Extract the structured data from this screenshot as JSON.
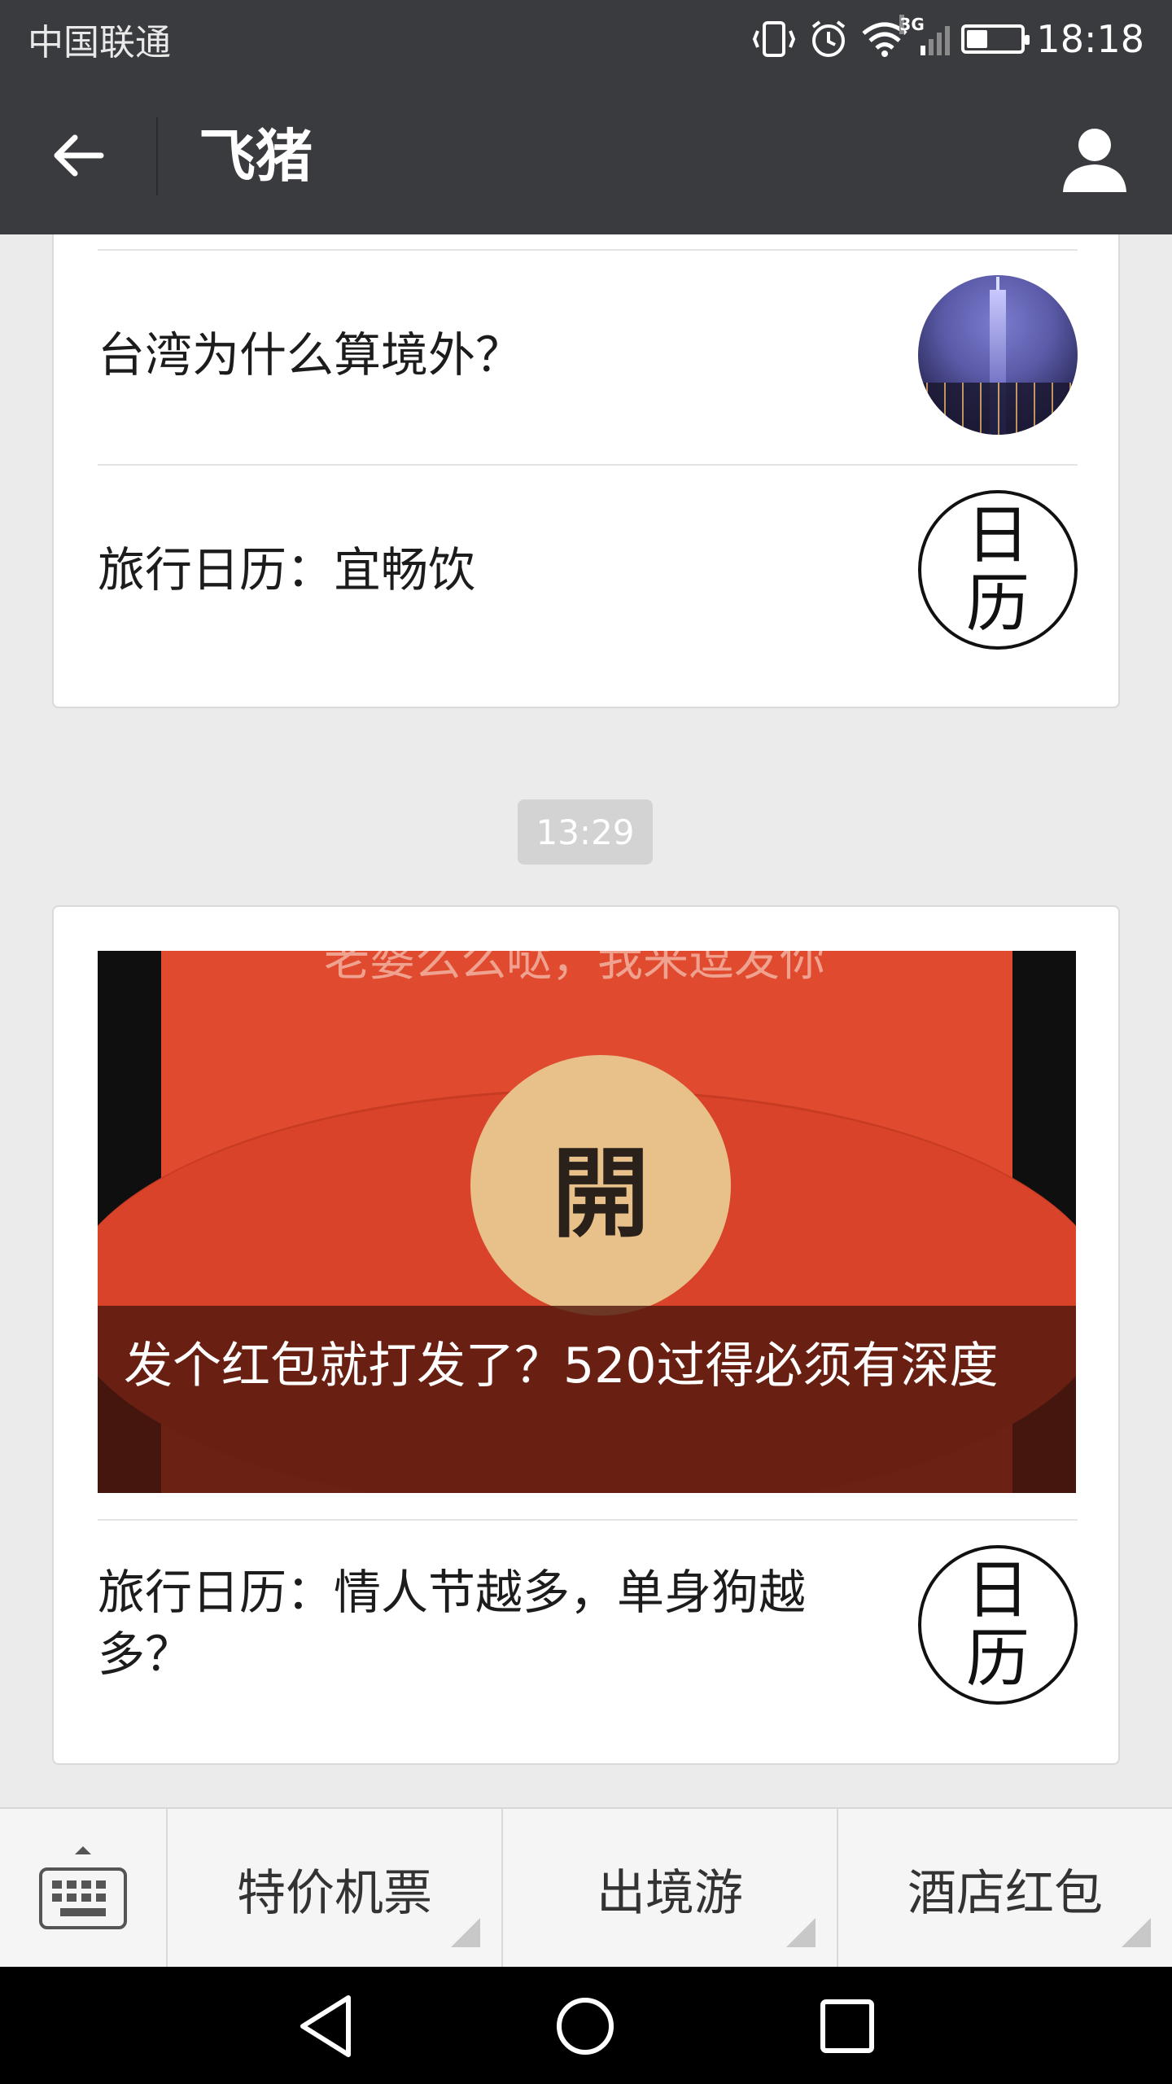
{
  "status_bar": {
    "carrier": "中国联通",
    "network": "3G",
    "battery_level": 0.35,
    "time": "18:18",
    "icons": [
      "vibrate-icon",
      "alarm-icon",
      "wifi-icon",
      "signal-icon",
      "battery-icon"
    ]
  },
  "nav": {
    "title": "飞猪",
    "back_icon": "back-arrow-icon",
    "profile_icon": "profile-icon"
  },
  "messages": {
    "top_card": {
      "items": [
        {
          "title": "台湾为什么算境外？",
          "thumb": "taipei-101-night-photo"
        },
        {
          "title": "旅行日历：宜畅饮",
          "thumb": "calendar-badge",
          "thumb_text": [
            "日",
            "历"
          ]
        }
      ]
    },
    "timestamp": "13:29",
    "bottom_card": {
      "hero": {
        "caption": "发个红包就打发了？520过得必须有深度",
        "overlay_text": "老婆么么哒，我来逗发你",
        "button_text": "開"
      },
      "items": [
        {
          "title": "旅行日历：情人节越多，单身狗越多？",
          "thumb": "calendar-badge",
          "thumb_text": [
            "日",
            "历"
          ]
        }
      ]
    }
  },
  "menu": {
    "items": [
      "特价机票",
      "出境游",
      "酒店红包"
    ],
    "keyboard_icon": "keyboard-icon"
  },
  "system_nav": [
    "back-triangle-icon",
    "home-circle-icon",
    "recents-square-icon"
  ]
}
